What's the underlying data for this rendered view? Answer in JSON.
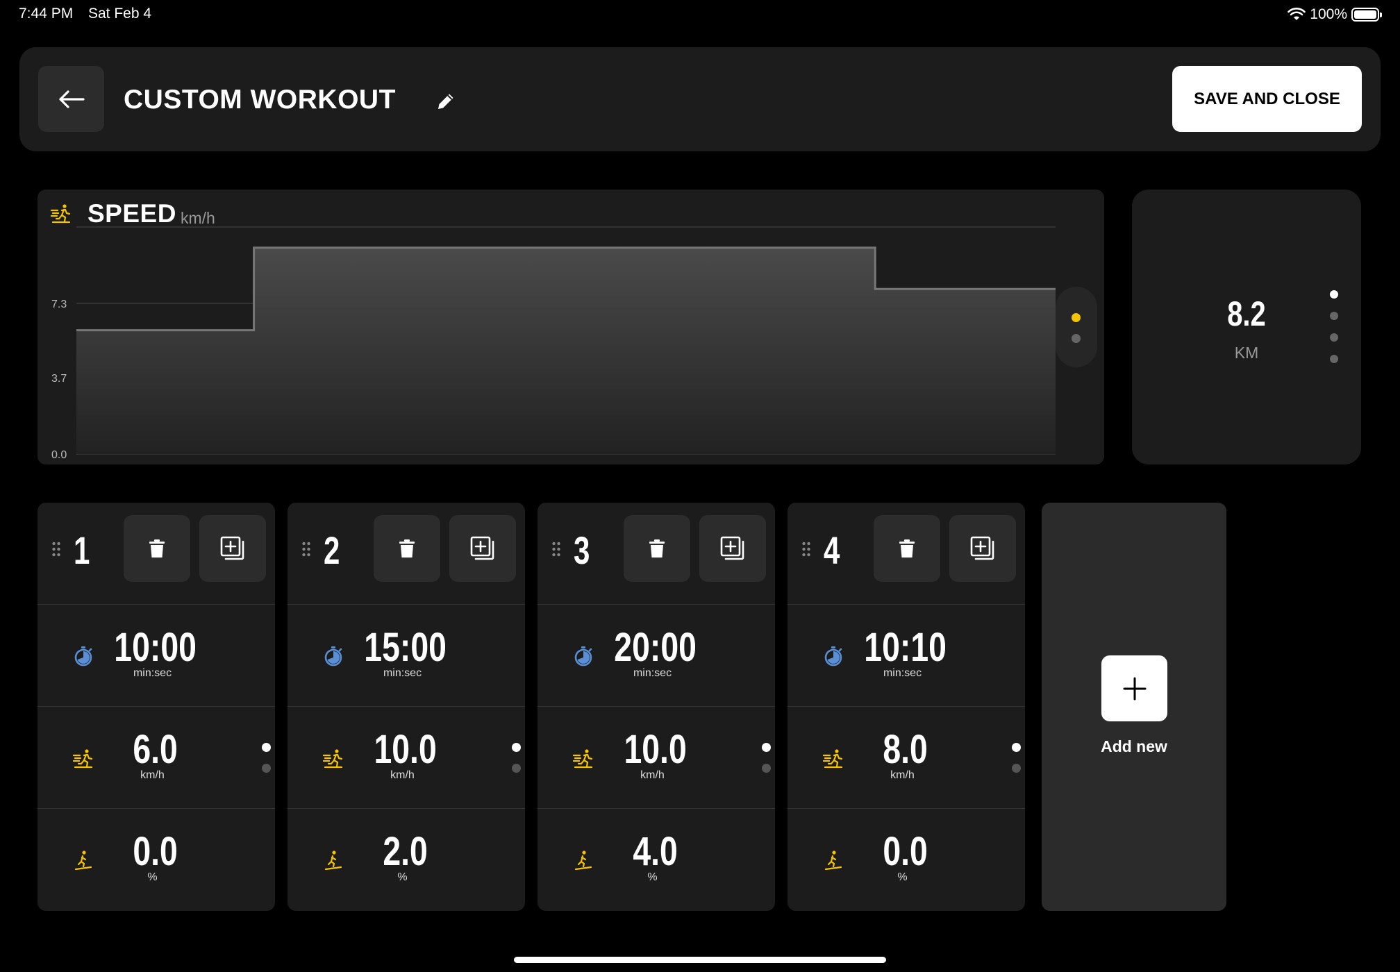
{
  "status_bar": {
    "time": "7:44 PM",
    "date": "Sat Feb 4",
    "battery": "100%"
  },
  "header": {
    "title": "CUSTOM WORKOUT",
    "save_label": "SAVE AND CLOSE"
  },
  "icons": {
    "back": "arrow-left-icon",
    "edit": "pencil-icon",
    "speed": "runner-speed-icon",
    "timer": "stopwatch-icon",
    "incline": "incline-walker-icon",
    "delete": "trash-icon",
    "duplicate": "duplicate-icon",
    "drag": "drag-handle-icon",
    "add": "plus-icon"
  },
  "colors": {
    "accent_yellow": "#f5c400",
    "timer_blue": "#5a8fd6",
    "card_bg": "#1c1c1c"
  },
  "chart_data": {
    "type": "area",
    "title": "SPEED",
    "unit": "km/h",
    "y_ticks": [
      "7.3",
      "3.7",
      "0.0"
    ],
    "y_tick_values": [
      7.3,
      3.7,
      0.0
    ],
    "ylim": [
      0,
      11
    ],
    "steps": [
      {
        "duration_sec": 600,
        "value": 6.0
      },
      {
        "duration_sec": 900,
        "value": 10.0
      },
      {
        "duration_sec": 1200,
        "value": 10.0
      },
      {
        "duration_sec": 610,
        "value": 8.0
      }
    ],
    "grid": true
  },
  "distance": {
    "value": "8.2",
    "unit": "KM"
  },
  "segments": [
    {
      "number": "1",
      "time": "10:00",
      "time_unit": "min:sec",
      "speed": "6.0",
      "speed_unit": "km/h",
      "incline": "0.0",
      "incline_unit": "%"
    },
    {
      "number": "2",
      "time": "15:00",
      "time_unit": "min:sec",
      "speed": "10.0",
      "speed_unit": "km/h",
      "incline": "2.0",
      "incline_unit": "%"
    },
    {
      "number": "3",
      "time": "20:00",
      "time_unit": "min:sec",
      "speed": "10.0",
      "speed_unit": "km/h",
      "incline": "4.0",
      "incline_unit": "%"
    },
    {
      "number": "4",
      "time": "10:10",
      "time_unit": "min:sec",
      "speed": "8.0",
      "speed_unit": "km/h",
      "incline": "0.0",
      "incline_unit": "%"
    }
  ],
  "add_new": {
    "label": "Add new"
  }
}
